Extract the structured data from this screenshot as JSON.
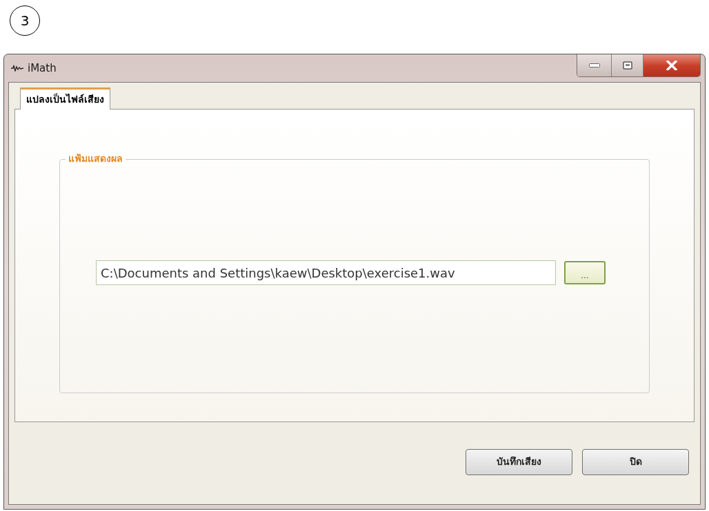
{
  "step_badge": "3",
  "window": {
    "title": "iMath"
  },
  "tabs": [
    {
      "label": "แปลงเป็นไฟล์เสียง",
      "selected": true
    }
  ],
  "group": {
    "title": "แฟ้มแสดงผล",
    "file_path": "C:\\Documents and Settings\\kaew\\Desktop\\exercise1.wav",
    "browse_button": "..."
  },
  "buttons": [
    "บันทึกเสียง",
    "ปิด"
  ]
}
